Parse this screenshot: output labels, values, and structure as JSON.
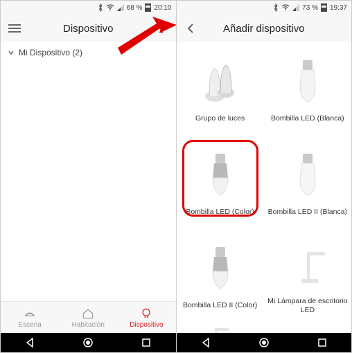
{
  "left": {
    "status": {
      "battery_pct": "68 %",
      "time": "20:10"
    },
    "header": {
      "title": "Dispositivo"
    },
    "group": {
      "label": "Mi Dispositivo (2)"
    },
    "tabs": {
      "scene": "Escena",
      "room": "Habitación",
      "device": "Dispositivo"
    }
  },
  "right": {
    "status": {
      "battery_pct": "73 %",
      "time": "19:37"
    },
    "header": {
      "title": "Añadir dispositivo"
    },
    "products": [
      {
        "label": "Grupo de luces"
      },
      {
        "label": "Bombilla LED (Blanca)"
      },
      {
        "label": "Bombilla LED (Color)"
      },
      {
        "label": "Bombilla LED II (Blanca)"
      },
      {
        "label": "Bombilla LED II (Color)"
      },
      {
        "label": "Mi Lámpara de escritorio LED"
      }
    ],
    "highlight_index": 2
  }
}
